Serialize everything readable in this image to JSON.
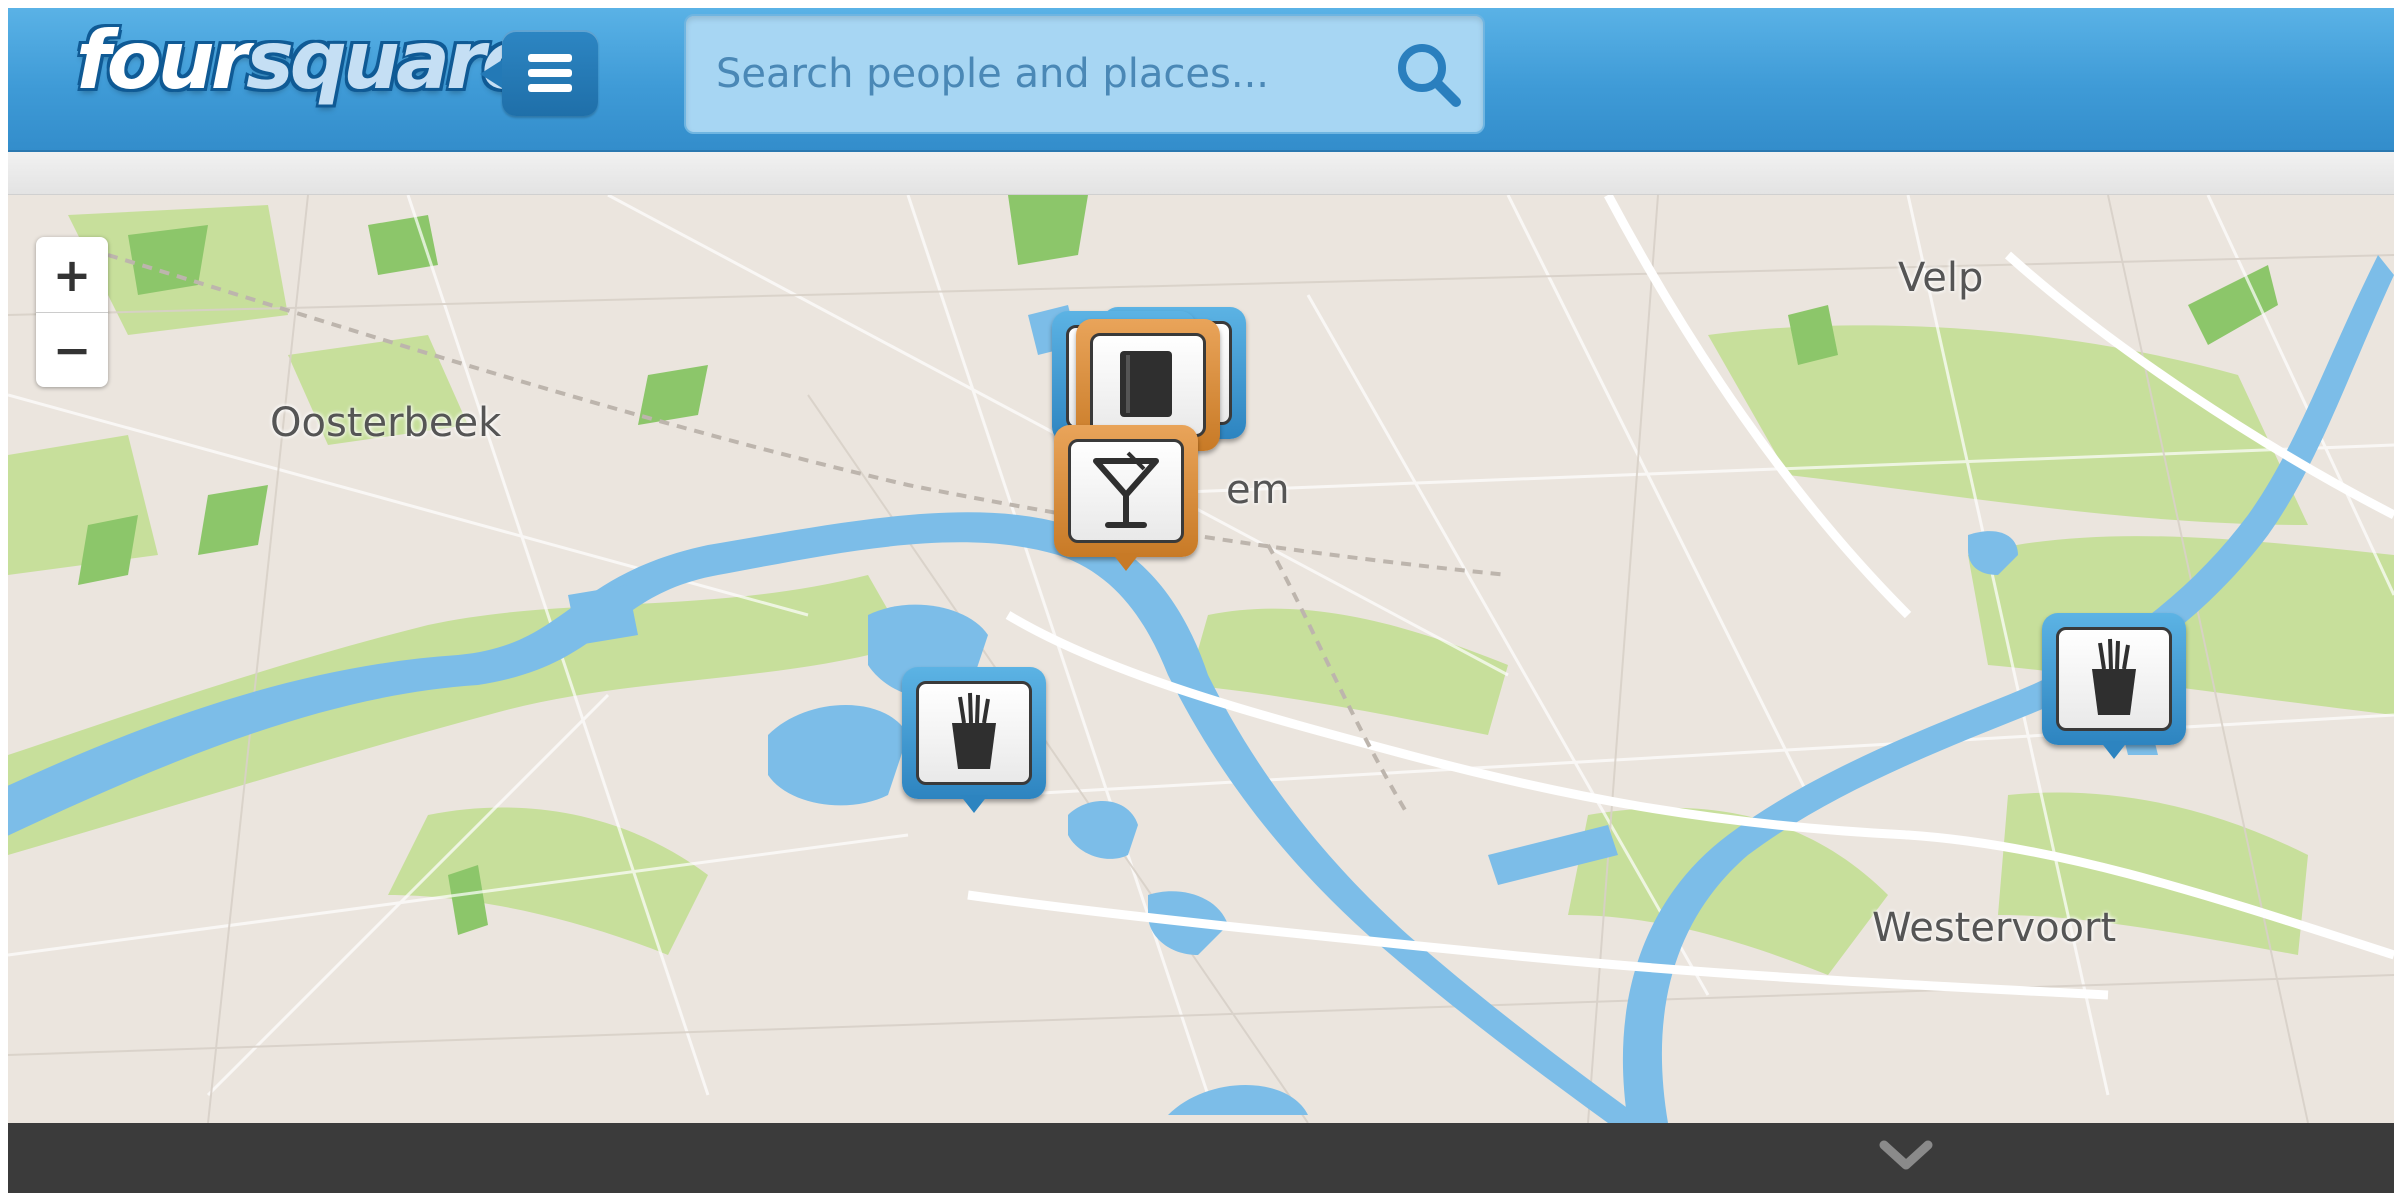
{
  "header": {
    "logo_part1": "four",
    "logo_part2": "square",
    "search": {
      "placeholder": "Search people and places..."
    }
  },
  "map": {
    "zoom_in_label": "+",
    "zoom_out_label": "−",
    "places": [
      {
        "label": "Oosterbeek"
      },
      {
        "label": "Velp"
      },
      {
        "label": "em"
      },
      {
        "label": "Westervoort"
      }
    ],
    "pins": [
      {
        "category": "food-icon",
        "color": "blue"
      },
      {
        "category": "food-icon",
        "color": "blue"
      },
      {
        "category": "cocktail-icon",
        "color": "orange"
      },
      {
        "category": "book-icon",
        "color": "orange"
      },
      {
        "category": "camera-icon",
        "color": "blue"
      }
    ]
  },
  "colors": {
    "header_blue": "#3f9bd7",
    "water": "#7cbde8",
    "park": "#c7df9b",
    "pin_blue": "#2d84c0",
    "pin_orange": "#c87a26"
  }
}
